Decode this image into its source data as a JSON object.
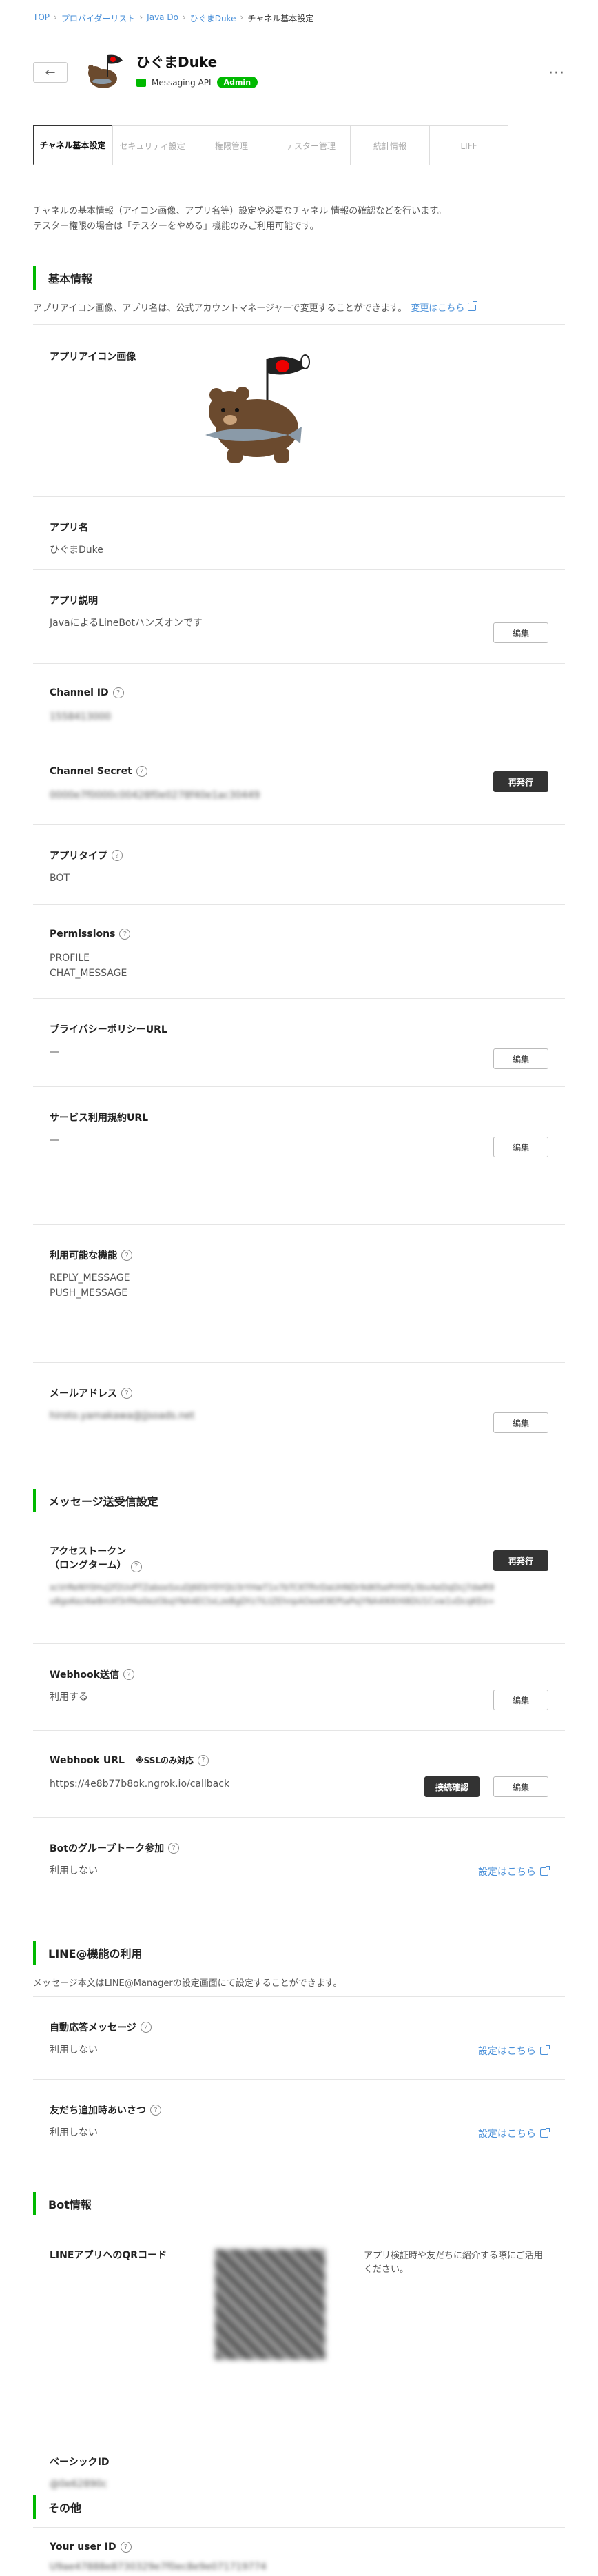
{
  "breadcrumb": [
    "TOP",
    "プロバイダーリスト",
    "Java Do",
    "ひぐまDuke",
    "チャネル基本設定"
  ],
  "header": {
    "title": "ひぐまDuke",
    "type": "Messaging API",
    "role": "Admin"
  },
  "tabs": [
    "チャネル基本設定",
    "セキュリティ設定",
    "権限管理",
    "テスター管理",
    "統計情報",
    "LIFF"
  ],
  "intro": [
    "チャネルの基本情報（アイコン画像、アプリ名等）設定や必要なチャネル 情報の確認などを行います。",
    "テスター権限の場合は「テスターをやめる」機能のみご利用可能です。"
  ],
  "basic": {
    "heading": "基本情報",
    "sub": "アプリアイコン画像、アプリ名は、公式アカウントマネージャーで変更することができます。",
    "sub_link": "変更はこちら",
    "icon_label": "アプリアイコン画像",
    "app_name_label": "アプリ名",
    "app_name": "ひぐまDuke",
    "desc_label": "アプリ説明",
    "desc": "JavaによるLineBotハンズオンです",
    "channel_id_label": "Channel ID",
    "channel_id": "1558413000",
    "secret_label": "Channel Secret",
    "secret": "0000e7f0000c00428f0e0278f40e1ac30449",
    "type_label": "アプリタイプ",
    "type": "BOT",
    "perm_label": "Permissions",
    "perms": [
      "PROFILE",
      "CHAT_MESSAGE"
    ],
    "privacy_label": "プライバシーポリシーURL",
    "privacy": "—",
    "terms_label": "サービス利用規約URL",
    "terms": "—",
    "features_label": "利用可能な機能",
    "features": [
      "REPLY_MESSAGE",
      "PUSH_MESSAGE"
    ],
    "email_label": "メールアドレス",
    "email": "hiroto.yamakawa@jjsoads.net"
  },
  "messaging": {
    "heading": "メッセージ送受信設定",
    "token_label": "アクセストークン\n（ロングターム）",
    "token": "xcVrReNY0HvJ2f2UvPTZaboxSxuDJ6EbY0YQU3rYHwT1x7bTCKTfhrDaUHNDr9dKfsePrHtFy3bvAeDqDcj7dwR9u8goKez4w8mXf3rPAo0ezObqYNA4ECtxLzeBgDYz7ILtZEhnpAOeeK9EPtaPojYNA4lKKHI8DU1Cvw1vDcqKEo=",
    "webhook_label": "Webhook送信",
    "webhook": "利用する",
    "url_label": "Webhook URL",
    "url_note": "※SSLのみ対応",
    "url": "https://4e8b77b8ok.ngrok.io/callback",
    "group_label": "Botのグループトーク参加",
    "group": "利用しない"
  },
  "lineat": {
    "heading": "LINE@機能の利用",
    "sub": "メッセージ本文はLINE@Managerの設定画面にて設定することができます。",
    "auto_label": "自動応答メッセージ",
    "auto": "利用しない",
    "friend_label": "友だち追加時あいさつ",
    "friend": "利用しない"
  },
  "bot": {
    "heading": "Bot情報",
    "qr_label": "LINEアプリへのQRコード",
    "qr_note": "アプリ検証時や友だちに紹介する際にご活用ください。",
    "basic_id_label": "ベーシックID",
    "basic_id": "@0e62890c"
  },
  "other": {
    "heading": "その他",
    "user_label": "Your user ID",
    "user_id": "U9ae47888e8730329e7f0ec8e9e071719774"
  },
  "labels": {
    "edit": "編集",
    "reissue": "再発行",
    "verify": "接続確認",
    "set_here": "設定はこちら"
  }
}
